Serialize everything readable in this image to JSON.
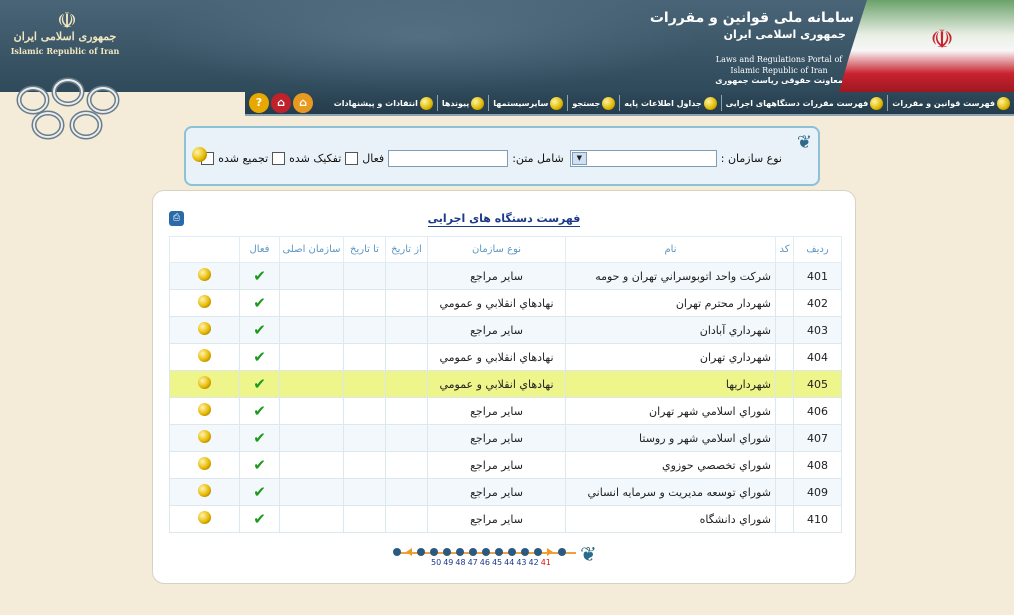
{
  "header": {
    "left_title": "جمهوری اسلامی ایران",
    "left_subtitle": "Islamic Republic of Iran",
    "portal_title": "سامانه ملی قوانین و مقررات",
    "portal_subtitle": "جمهوری اسلامی ایران",
    "portal_english": "Laws and Regulations Portal of Islamic Republic of Iran",
    "department": "معاونت حقوقی ریاست جمهوری"
  },
  "nav": {
    "items": [
      {
        "label": "فهرست قوانين و مقررات"
      },
      {
        "label": "فهرست مقررات دستگاههای اجرایی"
      },
      {
        "label": "جداول اطلاعات پایه"
      },
      {
        "label": "جستجو"
      },
      {
        "label": "سایرسیستمها"
      },
      {
        "label": "پیوندها"
      },
      {
        "label": "انتقادات و پیشنهادات"
      }
    ],
    "help_glyph": "?",
    "home_glyph": "⌂"
  },
  "search": {
    "org_type_label": "نوع سازمان :",
    "org_type_value": "",
    "text_label": "شامل متن:",
    "text_value": "",
    "active_label": "فعال",
    "separated_label": "تفکیک شده",
    "merged_label": "تجمیع شده"
  },
  "panel": {
    "title": "فهرست دستگاه های اجرایی"
  },
  "table": {
    "headers": [
      "رديف",
      "کد",
      "نام",
      "نوع سازمان",
      "از تاريخ",
      "تا تاريخ",
      "سازمان اصلی",
      "فعال"
    ],
    "rows": [
      {
        "idx": "401",
        "name": "شرکت واحد اتوبوسراني تهران و حومه",
        "type": "ساير مراجع",
        "active": true
      },
      {
        "idx": "402",
        "name": "شهردار محترم تهران",
        "type": "نهادهاي انقلابي و عمومي",
        "active": true
      },
      {
        "idx": "403",
        "name": "شهرداري آبادان",
        "type": "ساير مراجع",
        "active": true
      },
      {
        "idx": "404",
        "name": "شهرداري تهران",
        "type": "نهادهاي انقلابي و عمومي",
        "active": true
      },
      {
        "idx": "405",
        "name": "شهرداريها",
        "type": "نهادهاي انقلابي و عمومي",
        "active": true,
        "selected": true
      },
      {
        "idx": "406",
        "name": "شوراي اسلامي شهر تهران",
        "type": "ساير مراجع",
        "active": true
      },
      {
        "idx": "407",
        "name": "شوراي اسلامي شهر و روستا",
        "type": "ساير مراجع",
        "active": true
      },
      {
        "idx": "408",
        "name": "شوراي تخصصي حوزوي",
        "type": "ساير مراجع",
        "active": true
      },
      {
        "idx": "409",
        "name": "شوراي توسعه مديريت و سرمايه انساني",
        "type": "ساير مراجع",
        "active": true
      },
      {
        "idx": "410",
        "name": "شوراي دانشگاه",
        "type": "ساير مراجع",
        "active": true
      }
    ]
  },
  "pager": {
    "pages": [
      "41",
      "42",
      "43",
      "44",
      "45",
      "46",
      "47",
      "48",
      "49",
      "50"
    ],
    "current": "41"
  },
  "colors": {
    "header_bg": "#3b5667",
    "page_bg": "#f4ecd9",
    "panel_border": "#8cc1d6",
    "highlight_row": "#eef58a",
    "title_blue": "#1b3a8c",
    "check_green": "#1c9a1c",
    "pager_current": "#d11111"
  }
}
